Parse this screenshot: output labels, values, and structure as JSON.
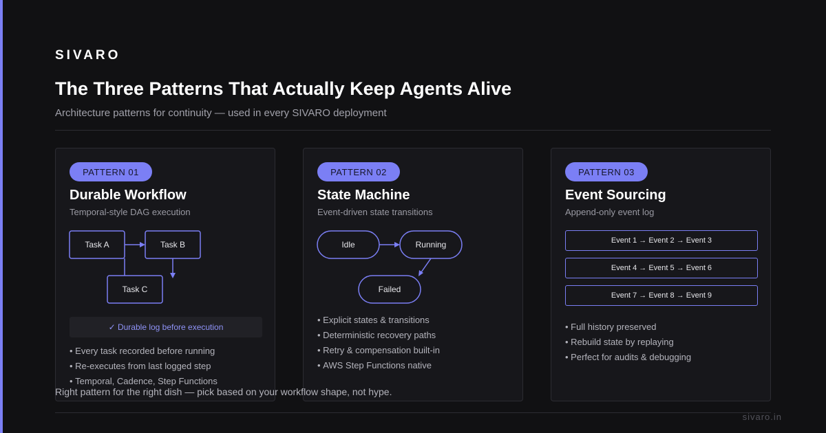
{
  "brand": "SIVARO",
  "title": "The Three Patterns That Actually Keep Agents Alive",
  "subtitle": "Architecture patterns for continuity — used in every SIVARO deployment",
  "colors": {
    "background": "#111113",
    "accent": "#7b7ff5",
    "card": "#17171b"
  },
  "cards": [
    {
      "pill": "PATTERN 01",
      "title": "Durable Workflow",
      "subtitle": "Temporal-style DAG execution",
      "nodes": [
        "Task A",
        "Task B",
        "Task C"
      ],
      "log_note": "✓ Durable log before execution",
      "bullets": [
        "Every task recorded before running",
        "Re-executes from last logged step",
        "Temporal, Cadence, Step Functions"
      ]
    },
    {
      "pill": "PATTERN 02",
      "title": "State Machine",
      "subtitle": "Event-driven state transitions",
      "nodes": [
        "Idle",
        "Running",
        "Failed"
      ],
      "bullets": [
        "Explicit states & transitions",
        "Deterministic recovery paths",
        "Retry & compensation built-in",
        "AWS Step Functions native"
      ]
    },
    {
      "pill": "PATTERN 03",
      "title": "Event Sourcing",
      "subtitle": "Append-only event log",
      "events": [
        "Event 1 → Event 2 → Event 3",
        "Event 4 → Event 5 → Event 6",
        "Event 7 → Event 8 → Event 9"
      ],
      "bullets": [
        "Full history preserved",
        "Rebuild state by replaying",
        "Perfect for audits & debugging"
      ]
    }
  ],
  "footer": {
    "note": "Right pattern for the right dish — pick based on your workflow shape, not hype.",
    "url": "sivaro.in"
  }
}
